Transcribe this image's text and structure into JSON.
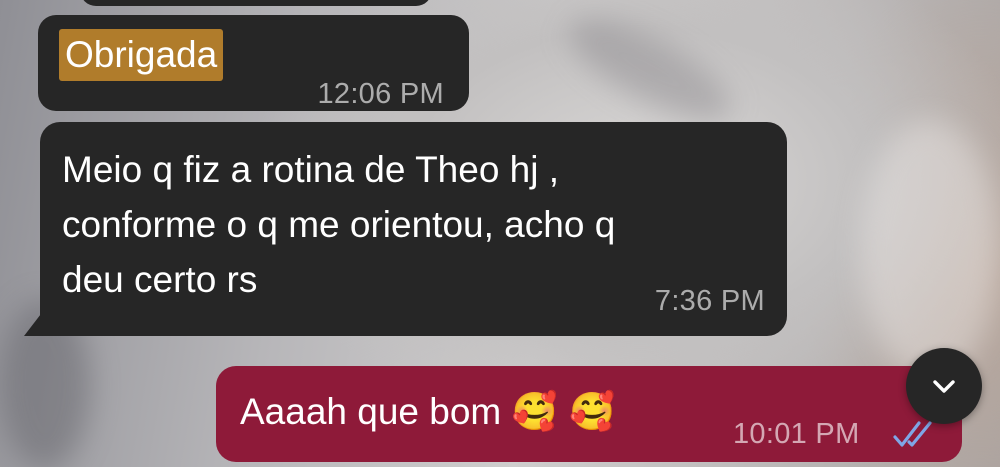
{
  "messages": [
    {
      "direction": "incoming",
      "text": "Obrigada",
      "highlighted": true,
      "highlight_color": "#b07c2b",
      "time": "12:06 PM"
    },
    {
      "direction": "incoming",
      "lines": [
        "Meio q fiz a rotina de Theo hj ,",
        "conforme o q me orientou, acho q",
        "deu certo rs"
      ],
      "time": "7:36 PM"
    },
    {
      "direction": "outgoing",
      "text": "Aaaah que bom",
      "emojis": "🥰 🥰",
      "time": "10:01 PM",
      "status_icon": "double-check-icon",
      "status_color": "#7fa6e6"
    }
  ],
  "scroll_button": {
    "icon": "chevron-down-icon"
  },
  "colors": {
    "incoming_bubble": "#262626",
    "outgoing_bubble": "#8e1a39",
    "text": "#ffffff"
  }
}
